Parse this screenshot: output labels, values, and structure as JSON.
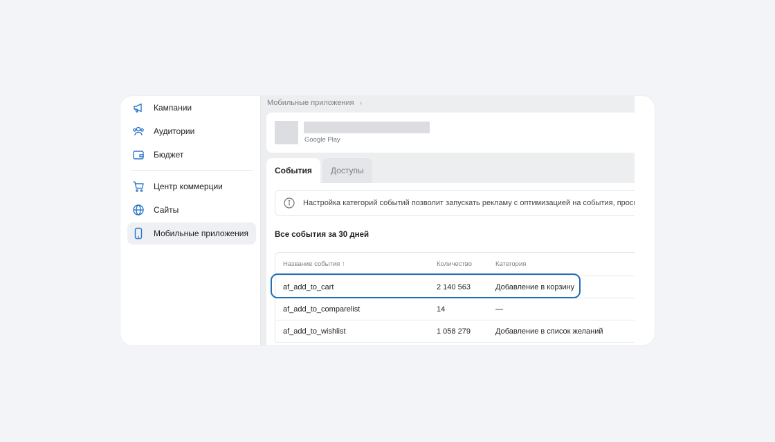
{
  "sidebar": {
    "items": [
      {
        "label": "Кампании",
        "icon": "megaphone-icon"
      },
      {
        "label": "Аудитории",
        "icon": "users-icon"
      },
      {
        "label": "Бюджет",
        "icon": "wallet-icon"
      },
      {
        "label": "Центр коммерции",
        "icon": "cart-icon"
      },
      {
        "label": "Сайты",
        "icon": "globe-icon"
      },
      {
        "label": "Мобильные приложения",
        "icon": "phone-icon",
        "active": true
      }
    ]
  },
  "breadcrumb": {
    "text": "Мобильные приложения"
  },
  "app": {
    "store": "Google Play"
  },
  "tabs": [
    {
      "label": "События",
      "active": true
    },
    {
      "label": "Доступы",
      "active": false
    }
  ],
  "info": {
    "text": "Настройка категорий событий позволит запускать рекламу с оптимизацией на события, просматр"
  },
  "section_title": "Все события за 30 дней",
  "table": {
    "headers": {
      "name": "Название события ↑",
      "count": "Количество",
      "category": "Категория"
    },
    "rows": [
      {
        "name": "af_add_to_cart",
        "count": "2 140 563",
        "category": "Добавление в корзину"
      },
      {
        "name": "af_add_to_comparelist",
        "count": "14",
        "category": "—"
      },
      {
        "name": "af_add_to_wishlist",
        "count": "1 058 279",
        "category": "Добавление в список желаний"
      }
    ]
  },
  "colors": {
    "accent": "#2c76c9",
    "highlight": "#1f6fb3",
    "page_bg": "#f3f4f7"
  }
}
